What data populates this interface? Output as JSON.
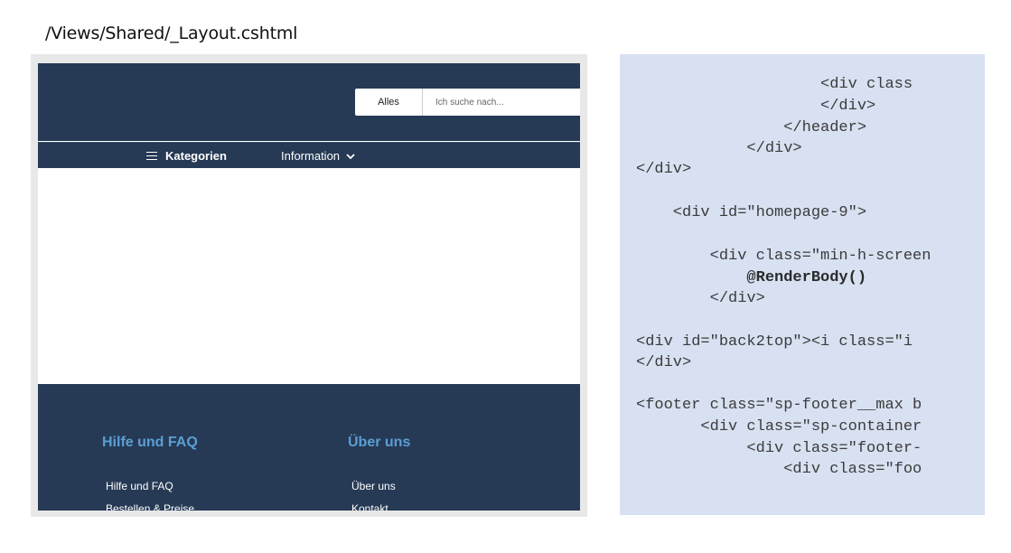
{
  "file_path": "/Views/Shared/_Layout.cshtml",
  "site": {
    "search": {
      "scope": "Alles",
      "placeholder": "Ich suche nach..."
    },
    "nav": {
      "categories": "Kategorien",
      "information": "Information"
    },
    "footer": {
      "col1": {
        "heading": "Hilfe und FAQ",
        "links": [
          "Hilfe und FAQ",
          "Bestellen & Preise"
        ]
      },
      "col2": {
        "heading": "Über uns",
        "links": [
          "Über uns",
          "Kontakt"
        ]
      }
    }
  },
  "code_lines": [
    "                    <div class",
    "                    </div>",
    "                </header>",
    "            </div>",
    "</div>",
    "",
    "    <div id=\"homepage-9\">",
    "",
    "        <div class=\"min-h-screen",
    "            @RenderBody()",
    "        </div>",
    "",
    "<div id=\"back2top\"><i class=\"i",
    "</div>",
    "",
    "<footer class=\"sp-footer__max b",
    "       <div class=\"sp-container",
    "            <div class=\"footer-",
    "                <div class=\"foo"
  ],
  "colors": {
    "header_bg": "#263a55",
    "footer_heading": "#5a9fd4",
    "code_bg": "#d7e1f1"
  },
  "icons": [
    "hamburger-icon",
    "chevron-down-icon"
  ]
}
